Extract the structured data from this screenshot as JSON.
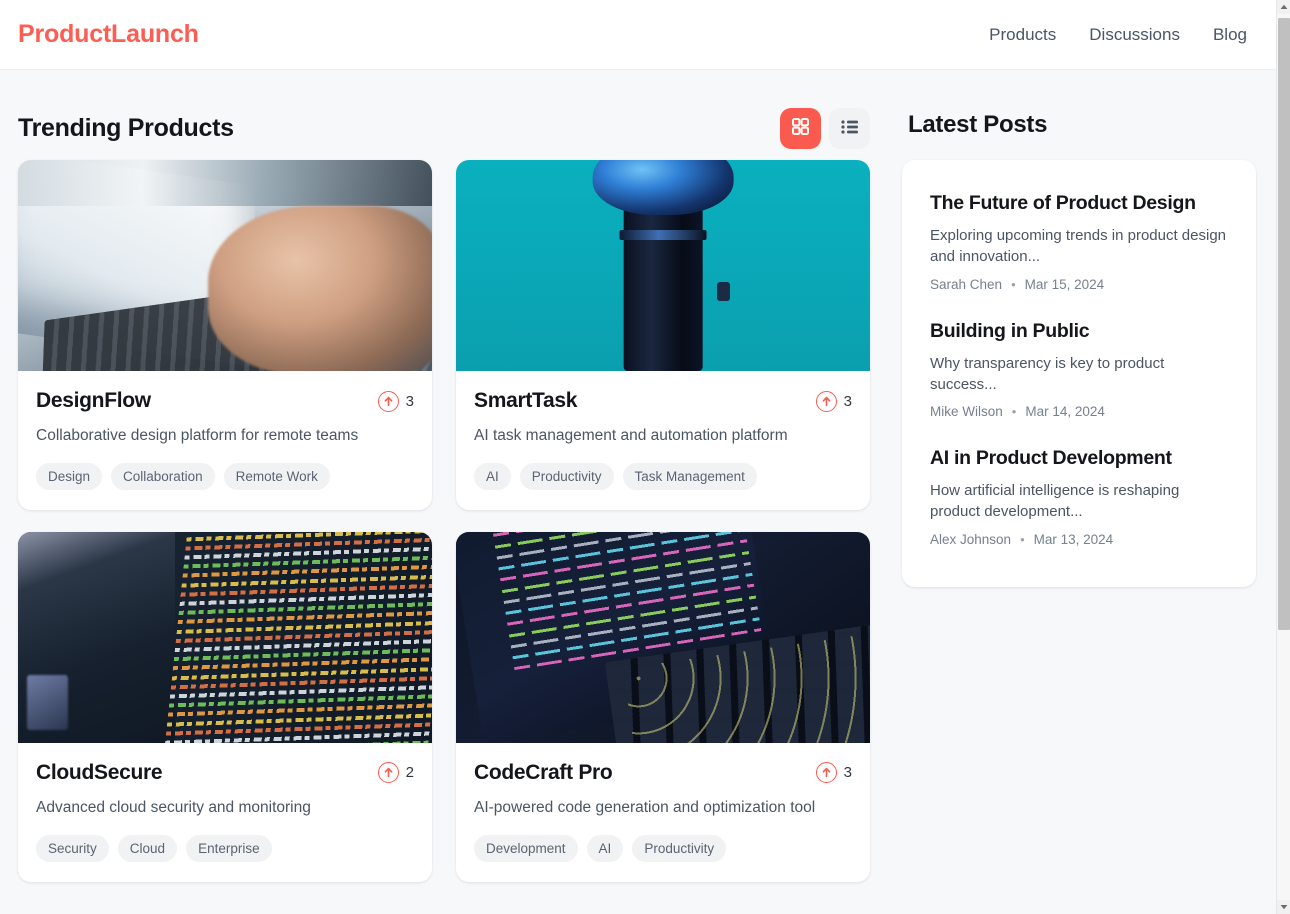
{
  "header": {
    "logo": "ProductLaunch",
    "nav": [
      {
        "label": "Products"
      },
      {
        "label": "Discussions"
      },
      {
        "label": "Blog"
      }
    ]
  },
  "main": {
    "section_title": "Trending Products",
    "view_toggle": {
      "grid_label": "grid-view",
      "list_label": "list-view",
      "active": "grid",
      "active_color": "#fb5a4f",
      "inactive_color": "#f1f2f4"
    },
    "products": [
      {
        "name": "DesignFlow",
        "description": "Collaborative design platform for remote teams",
        "votes": "3",
        "tags": [
          "Design",
          "Collaboration",
          "Remote Work"
        ],
        "image_alt": "hands-typing-on-laptop"
      },
      {
        "name": "SmartTask",
        "description": "AI task management and automation platform",
        "votes": "3",
        "tags": [
          "AI",
          "Productivity",
          "Task Management"
        ],
        "image_alt": "dark-device-on-teal-background"
      },
      {
        "name": "CloudSecure",
        "description": "Advanced cloud security and monitoring",
        "votes": "2",
        "tags": [
          "Security",
          "Cloud",
          "Enterprise"
        ],
        "image_alt": "colorful-code-on-dark-screen"
      },
      {
        "name": "CodeCraft Pro",
        "description": "AI-powered code generation and optimization tool",
        "votes": "3",
        "tags": [
          "Development",
          "AI",
          "Productivity"
        ],
        "image_alt": "laptop-screen-with-php-code"
      }
    ]
  },
  "sidebar": {
    "title": "Latest Posts",
    "posts": [
      {
        "title": "The Future of Product Design",
        "excerpt": "Exploring upcoming trends in product design and innovation...",
        "author": "Sarah Chen",
        "separator": "•",
        "date": "Mar 15, 2024"
      },
      {
        "title": "Building in Public",
        "excerpt": "Why transparency is key to product success...",
        "author": "Mike Wilson",
        "separator": "•",
        "date": "Mar 14, 2024"
      },
      {
        "title": "AI in Product Development",
        "excerpt": "How artificial intelligence is reshaping product development...",
        "author": "Alex Johnson",
        "separator": "•",
        "date": "Mar 13, 2024"
      }
    ]
  },
  "theme": {
    "accent": "#fb5a4f",
    "page_bg": "#f7f8fa",
    "card_bg": "#ffffff",
    "text_primary": "#14161c",
    "text_secondary": "#4b5563"
  }
}
